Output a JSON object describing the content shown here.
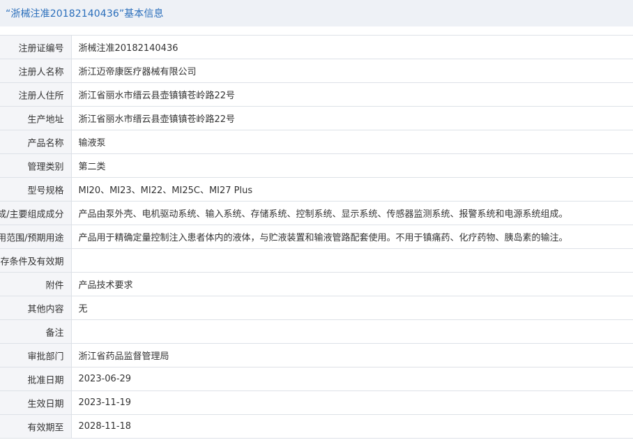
{
  "header": {
    "title": "“浙械注准20182140436”基本信息"
  },
  "rows": [
    {
      "label": "注册证编号",
      "value": "浙械注准20182140436"
    },
    {
      "label": "注册人名称",
      "value": "浙江迈帝康医疗器械有限公司"
    },
    {
      "label": "注册人住所",
      "value": "浙江省丽水市缙云县壶镇镇苍岭路22号"
    },
    {
      "label": "生产地址",
      "value": "浙江省丽水市缙云县壶镇镇苍岭路22号"
    },
    {
      "label": "产品名称",
      "value": "输液泵"
    },
    {
      "label": "管理类别",
      "value": "第二类"
    },
    {
      "label": "型号规格",
      "value": "MI20、MI23、MI22、MI25C、MI27 Plus"
    },
    {
      "label": "结构及组成/主要组成成分",
      "value": "产品由泵外壳、电机驱动系统、输入系统、存储系统、控制系统、显示系统、传感器监测系统、报警系统和电源系统组成。"
    },
    {
      "label": "适用范围/预期用途",
      "value": "产品用于精确定量控制注入患者体内的液体，与贮液装置和输液管路配套使用。不用于镇痛药、化疗药物、胰岛素的输注。"
    },
    {
      "label": "产品储存条件及有效期",
      "value": ""
    },
    {
      "label": "附件",
      "value": "产品技术要求"
    },
    {
      "label": "其他内容",
      "value": "无"
    },
    {
      "label": "备注",
      "value": ""
    },
    {
      "label": "审批部门",
      "value": "浙江省药品监督管理局"
    },
    {
      "label": "批准日期",
      "value": "2023-06-29"
    },
    {
      "label": "生效日期",
      "value": "2023-11-19"
    },
    {
      "label": "有效期至",
      "value": "2028-11-18"
    }
  ]
}
